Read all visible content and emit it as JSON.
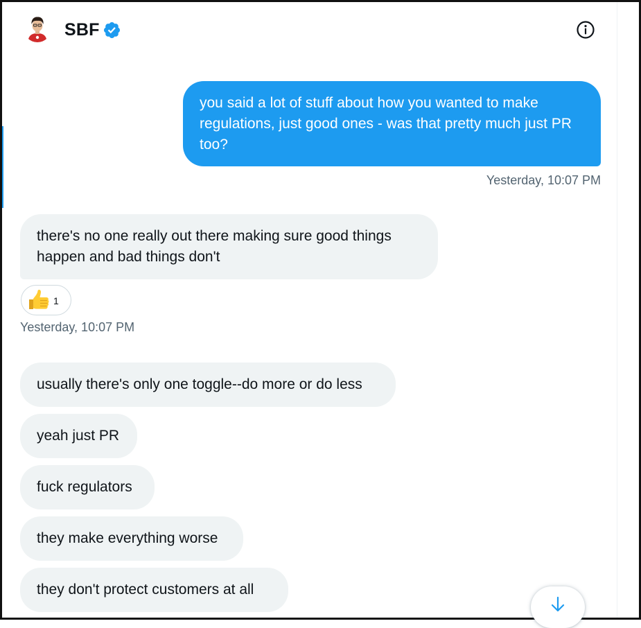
{
  "header": {
    "contact_name": "SBF",
    "verified": true
  },
  "messages": [
    {
      "direction": "sent",
      "text": "you said a lot of stuff about how you wanted to make regulations, just good ones - was that pretty much just PR too?"
    },
    {
      "direction": "received",
      "text": "there's no one really out there making sure good things happen and bad things don't"
    },
    {
      "direction": "received",
      "text": "usually there's only one toggle--do more or do less"
    },
    {
      "direction": "received",
      "text": "yeah just PR"
    },
    {
      "direction": "received",
      "text": "fuck regulators"
    },
    {
      "direction": "received",
      "text": "they make everything worse"
    },
    {
      "direction": "received",
      "text": "they don't protect customers at all"
    }
  ],
  "timestamps": {
    "sent": "Yesterday, 10:07 PM",
    "received": "Yesterday, 10:07 PM"
  },
  "reaction": {
    "emoji": "thumbs-up",
    "count": "1"
  },
  "icons": {
    "info": "info-icon",
    "verified": "verified-badge-icon",
    "scroll": "arrow-down-icon"
  },
  "colors": {
    "accent": "#1d9bf0",
    "received_bubble": "#eff3f4",
    "text_primary": "#0f1419",
    "text_secondary": "#536471"
  }
}
